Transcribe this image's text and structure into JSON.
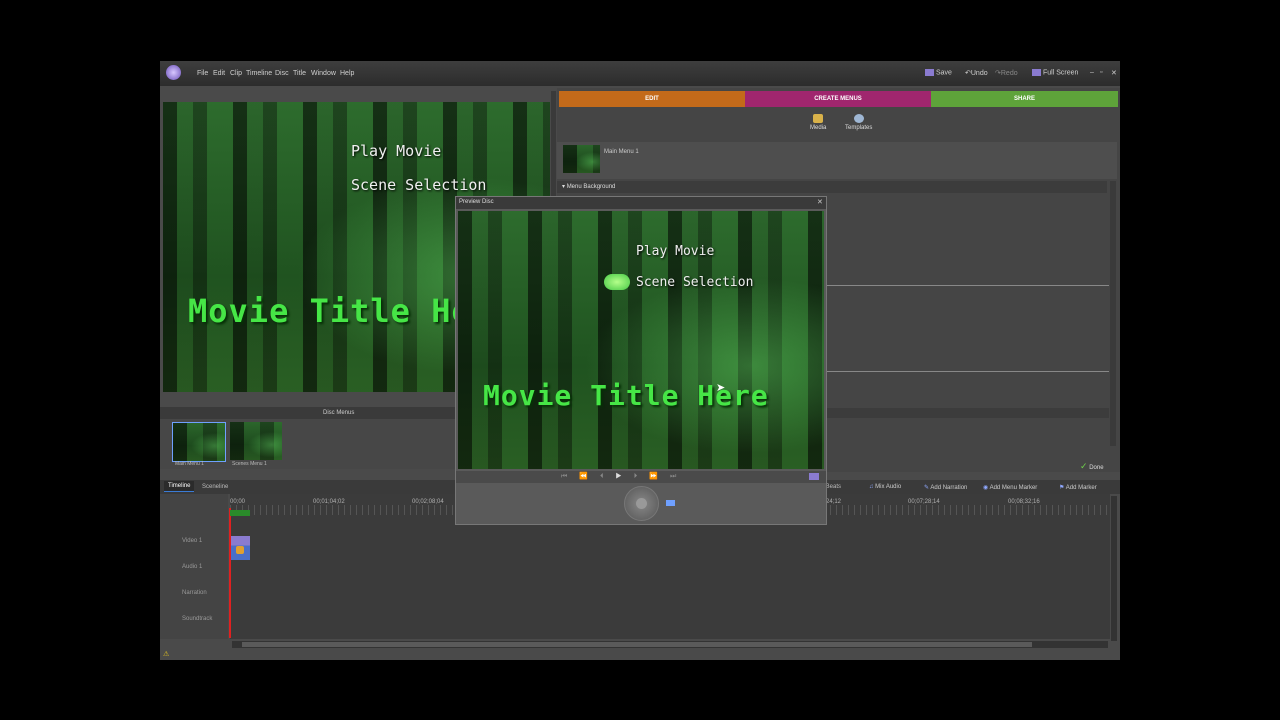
{
  "menu": [
    "File",
    "Edit",
    "Clip",
    "Timeline",
    "Disc",
    "Title",
    "Window",
    "Help"
  ],
  "toolbar": {
    "save": "Save",
    "undo": "Undo",
    "redo": "Redo",
    "fullscreen": "Full Screen"
  },
  "monitor": {
    "menu_items": [
      "Play Movie",
      "Scene Selection"
    ],
    "movie_title": "Movie Title Here"
  },
  "tabs": {
    "edit": "EDIT",
    "create": "CREATE MENUS",
    "share": "SHARE"
  },
  "tab_colors": {
    "edit": "#c36a1a",
    "create": "#a0266e",
    "share": "#5ea33a"
  },
  "panel": {
    "media": "Media",
    "templates": "Templates",
    "main_menu": "Main Menu 1",
    "menu_background": "Menu Background",
    "done": "Done"
  },
  "disc_menus": {
    "title": "Disc Menus",
    "thumbs": [
      "Main Menu 1",
      "Scenes Menu 1"
    ]
  },
  "timeline": {
    "tabs": [
      "Timeline",
      "Sceneline"
    ],
    "actions": [
      "Mix Audio",
      "Add Narration",
      "Add Menu Marker",
      "Add Marker"
    ],
    "partial_action": "ect Beats",
    "ruler": [
      "00;00",
      "00;01;04;02",
      "00;02;08;04",
      "24;12",
      "00;07;28;14",
      "00;08;32;16"
    ],
    "tracks": [
      "Video 1",
      "Audio 1",
      "Narration",
      "Soundtrack"
    ]
  },
  "preview": {
    "title": "Preview Disc",
    "menu_items": [
      "Play Movie",
      "Scene Selection"
    ],
    "movie_title": "Movie Title Here"
  }
}
